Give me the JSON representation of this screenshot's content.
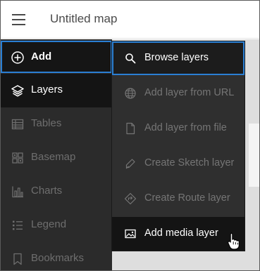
{
  "header": {
    "title": "Untitled map",
    "menu_icon": "hamburger-menu-icon"
  },
  "sidebar": {
    "items": [
      {
        "label": "Add",
        "icon": "plus-circle-icon",
        "state": "focused"
      },
      {
        "label": "Layers",
        "icon": "layers-icon",
        "state": "selected"
      },
      {
        "label": "Tables",
        "icon": "table-icon",
        "state": "disabled"
      },
      {
        "label": "Basemap",
        "icon": "basemap-grid-icon",
        "state": "disabled"
      },
      {
        "label": "Charts",
        "icon": "bar-chart-icon",
        "state": "disabled"
      },
      {
        "label": "Legend",
        "icon": "legend-list-icon",
        "state": "disabled"
      },
      {
        "label": "Bookmarks",
        "icon": "bookmark-icon",
        "state": "disabled"
      }
    ]
  },
  "add_menu": {
    "items": [
      {
        "label": "Browse layers",
        "icon": "search-icon",
        "state": "focused"
      },
      {
        "label": "Add layer from URL",
        "icon": "globe-icon",
        "state": "disabled"
      },
      {
        "label": "Add layer from file",
        "icon": "file-icon",
        "state": "disabled"
      },
      {
        "label": "Create Sketch layer",
        "icon": "pencil-icon",
        "state": "disabled"
      },
      {
        "label": "Create Route layer",
        "icon": "route-icon",
        "state": "disabled"
      },
      {
        "label": "Add media layer",
        "icon": "image-icon",
        "state": "hovered"
      }
    ]
  },
  "colors": {
    "focus_ring": "#2a7fd4",
    "sidebar_bg": "#2b2b2b",
    "menu_bg": "#2f2f2f",
    "active_text": "#ffffff",
    "disabled_text": "#6e6e6e"
  }
}
